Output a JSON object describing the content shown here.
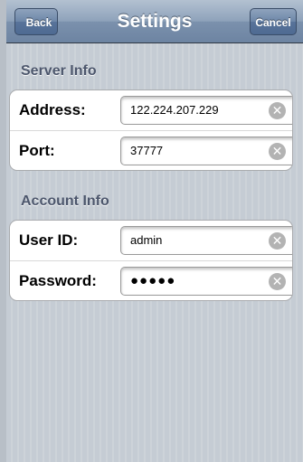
{
  "navbar": {
    "title": "Settings",
    "back_label": "Back",
    "cancel_label": "Cancel"
  },
  "sections": {
    "server": {
      "header": "Server Info",
      "address_label": "Address:",
      "address_value": "122.224.207.229",
      "port_label": "Port:",
      "port_value": "37777"
    },
    "account": {
      "header": "Account Info",
      "user_label": "User ID:",
      "user_value": "admin",
      "password_label": "Password:",
      "password_value": "●●●●●"
    }
  },
  "icons": {
    "clear": "clear-icon"
  },
  "colors": {
    "navbar": "#6d84a2",
    "background": "#c5ccd4",
    "section_header": "#4c566c"
  }
}
